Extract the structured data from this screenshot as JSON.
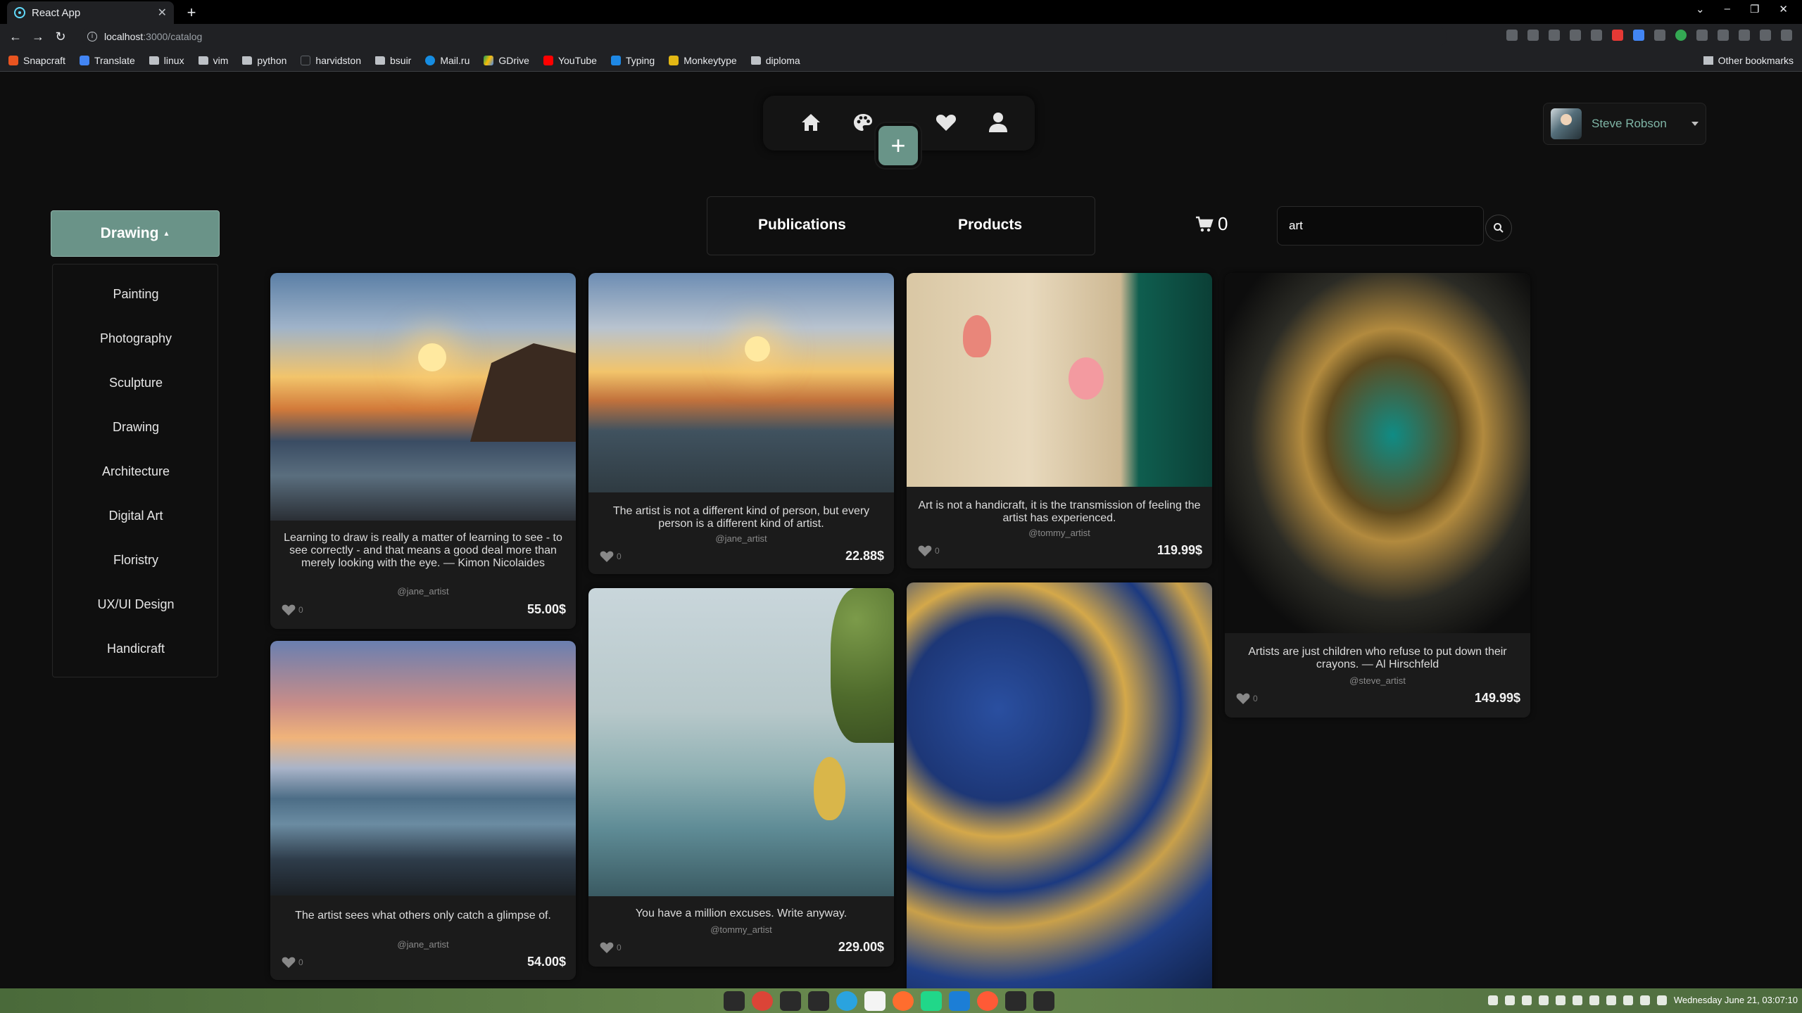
{
  "browser": {
    "tab_title": "React App",
    "url_host": "localhost",
    "url_rest": ":3000/catalog",
    "bookmarks": [
      "Snapcraft",
      "Translate",
      "linux",
      "vim",
      "python",
      "harvidston",
      "bsuir",
      "Mail.ru",
      "GDrive",
      "YouTube",
      "Typing",
      "Monkeytype",
      "diploma"
    ],
    "other_bookmarks": "Other bookmarks"
  },
  "user": {
    "name": "Steve Robson"
  },
  "sidebar": {
    "active_category": "Drawing",
    "categories": [
      "Painting",
      "Photography",
      "Sculpture",
      "Drawing",
      "Architecture",
      "Digital Art",
      "Floristry",
      "UX/UI Design",
      "Handicraft"
    ]
  },
  "tabs": {
    "publications": "Publications",
    "products": "Products"
  },
  "cart": {
    "count": "0"
  },
  "search": {
    "value": "art"
  },
  "cards": [
    {
      "quote": "Learning to draw is really a matter of learning to see - to see correctly - and that means a good deal more than merely looking with the eye. — Kimon Nicolaides",
      "author": "@jane_artist",
      "likes": "0",
      "price": "55.00$"
    },
    {
      "quote": "The artist sees what others only catch a glimpse of.",
      "author": "@jane_artist",
      "likes": "0",
      "price": "54.00$"
    },
    {
      "quote": "The artist is not a different kind of person, but every person is a different kind of artist.",
      "author": "@jane_artist",
      "likes": "0",
      "price": "22.88$"
    },
    {
      "quote": "You have a million excuses. Write anyway.",
      "author": "@tommy_artist",
      "likes": "0",
      "price": "229.00$"
    },
    {
      "quote": "Art is not a handicraft, it is the transmission of feeling the artist has experienced.",
      "author": "@tommy_artist",
      "likes": "0",
      "price": "119.99$"
    },
    {
      "quote": "Artists are just children who refuse to put down their crayons. — Al Hirschfeld",
      "author": "@steve_artist",
      "likes": "0",
      "price": "149.99$"
    }
  ],
  "taskbar": {
    "clock": "Wednesday June 21, 03:07:10"
  }
}
